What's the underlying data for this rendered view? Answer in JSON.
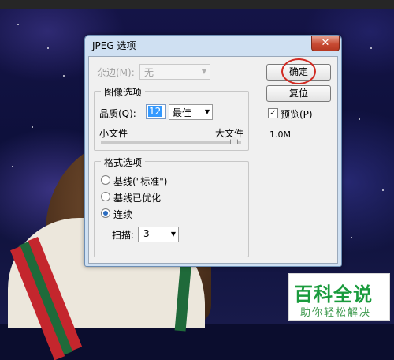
{
  "dialog": {
    "title": "JPEG 选项",
    "close_icon_glyph": "✕",
    "matte": {
      "label": "杂边(M):",
      "value": "无",
      "options": [
        "无"
      ]
    },
    "image_options": {
      "group_title": "图像选项",
      "quality_label": "品质(Q):",
      "quality_value": "12",
      "quality_preset": "最佳",
      "small_file_label": "小文件",
      "large_file_label": "大文件",
      "slider_level": 1.0
    },
    "format_options": {
      "group_title": "格式选项",
      "radios": [
        {
          "label": "基线(\"标准\")",
          "checked": false
        },
        {
          "label": "基线已优化",
          "checked": false
        },
        {
          "label": "连续",
          "checked": true
        }
      ],
      "scans_label": "扫描:",
      "scans_value": "3"
    },
    "ok_label": "确定",
    "reset_label": "复位",
    "preview_label": "预览(P)",
    "preview_checked": true,
    "file_size": "1.0M"
  },
  "watermark": {
    "title": "百科全说",
    "subtitle": "助你轻松解决"
  },
  "colors": {
    "dialog_frame": "#cfe0f2",
    "close_button": "#c74a32",
    "highlight_circle": "#d12a22",
    "selection": "#3399ff",
    "watermark_green": "#1a9b3d"
  }
}
